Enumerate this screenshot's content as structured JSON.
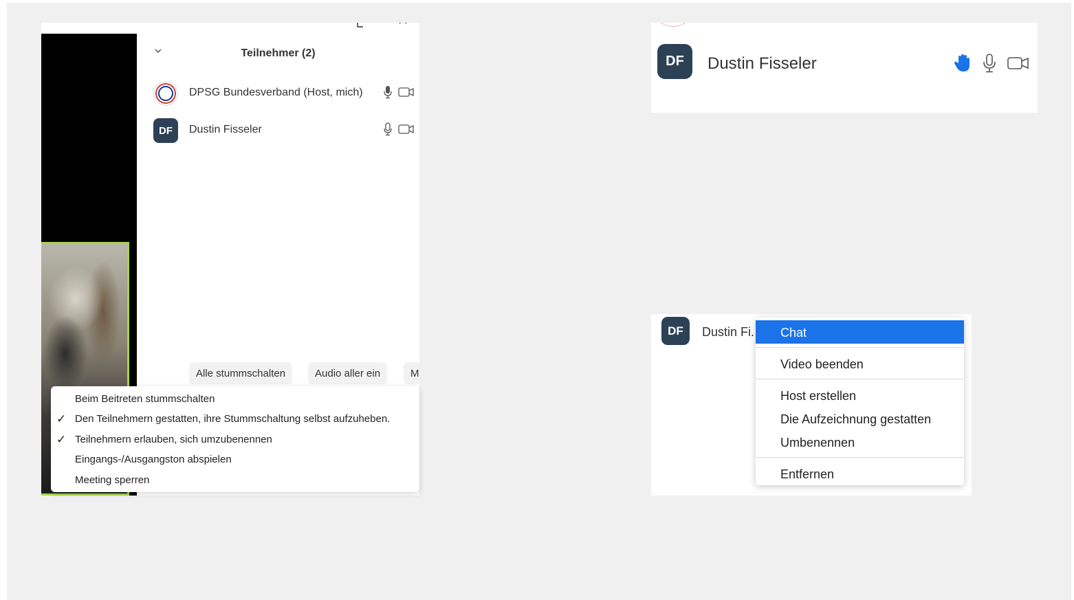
{
  "colors": {
    "accent": "#1a73e8",
    "avatar_bg": "#2d4156",
    "active_speaker_border": "#a6d645",
    "raised_hand": "#1a73e8"
  },
  "participants_panel": {
    "title": "Teilnehmer (2)",
    "participants": [
      {
        "name": "DPSG Bundesverband (Host, mich)",
        "avatar": "logo",
        "mic_icon": "mic-icon",
        "video_icon": "video-off-icon"
      },
      {
        "name": "Dustin Fisseler",
        "avatar_initials": "DF",
        "mic_icon": "mic-icon",
        "video_icon": "video-off-icon"
      }
    ],
    "buttons": {
      "mute_all": "Alle stummschalten",
      "unmute_all": "Audio aller ein",
      "more": "Mehr"
    },
    "more_menu": [
      {
        "label": "Beim Beitreten stummschalten",
        "checked": false
      },
      {
        "label": "Den Teilnehmern gestatten, ihre Stummschaltung selbst aufzuheben.",
        "checked": true
      },
      {
        "label": "Teilnehmern erlauben, sich umzubenennen",
        "checked": true
      },
      {
        "label": "Eingangs-/Ausgangston abspielen",
        "checked": false
      },
      {
        "label": "Meeting sperren",
        "checked": false
      }
    ],
    "check_glyph": "✓"
  },
  "zoomed_row": {
    "avatar_initials": "DF",
    "name": "Dustin Fisseler",
    "hand_raised": true
  },
  "context_row": {
    "avatar_initials": "DF",
    "name_truncated": "Dustin Fi.",
    "menu": {
      "chat": "Chat",
      "stop_video": "Video beenden",
      "make_host": "Host erstellen",
      "allow_record": "Die Aufzeichnung gestatten",
      "rename": "Umbenennen",
      "remove": "Entfernen"
    }
  }
}
